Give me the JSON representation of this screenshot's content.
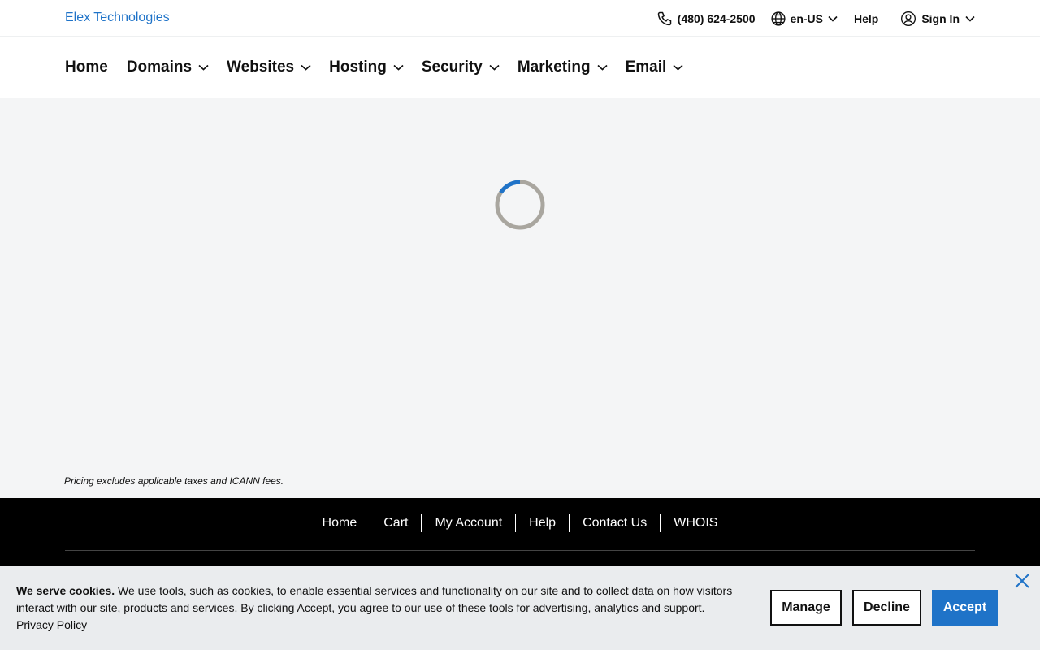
{
  "header": {
    "brand": "Elex Technologies",
    "phone": "(480) 624-2500",
    "language": "en-US",
    "help": "Help",
    "sign_in": "Sign In"
  },
  "nav": {
    "items": [
      {
        "label": "Home",
        "has_dropdown": false
      },
      {
        "label": "Domains",
        "has_dropdown": true
      },
      {
        "label": "Websites",
        "has_dropdown": true
      },
      {
        "label": "Hosting",
        "has_dropdown": true
      },
      {
        "label": "Security",
        "has_dropdown": true
      },
      {
        "label": "Marketing",
        "has_dropdown": true
      },
      {
        "label": "Email",
        "has_dropdown": true
      }
    ]
  },
  "content": {
    "loading": true,
    "disclaimer": "Pricing excludes applicable taxes and ICANN fees."
  },
  "footer": {
    "links": [
      "Home",
      "Cart",
      "My Account",
      "Help",
      "Contact Us",
      "WHOIS"
    ]
  },
  "cookie_banner": {
    "heading": "We serve cookies.",
    "body": "We use tools, such as cookies, to enable essential services and functionality on our site and to collect data on how visitors interact with our site, products and services. By clicking Accept, you agree to our use of these tools for advertising, analytics and support.",
    "privacy_link": "Privacy Policy",
    "manage_label": "Manage",
    "decline_label": "Decline",
    "accept_label": "Accept"
  },
  "colors": {
    "brand_blue": "#1f73c8",
    "spinner_track": "#a9a69f",
    "footer_bg": "#000000",
    "page_bg": "#f4f5f6",
    "cookie_bg": "#eaecee"
  },
  "icons": {
    "phone": "phone-icon",
    "language": "globe-icon",
    "user": "user-icon",
    "dropdown": "chevron-down-icon",
    "close": "close-icon"
  }
}
